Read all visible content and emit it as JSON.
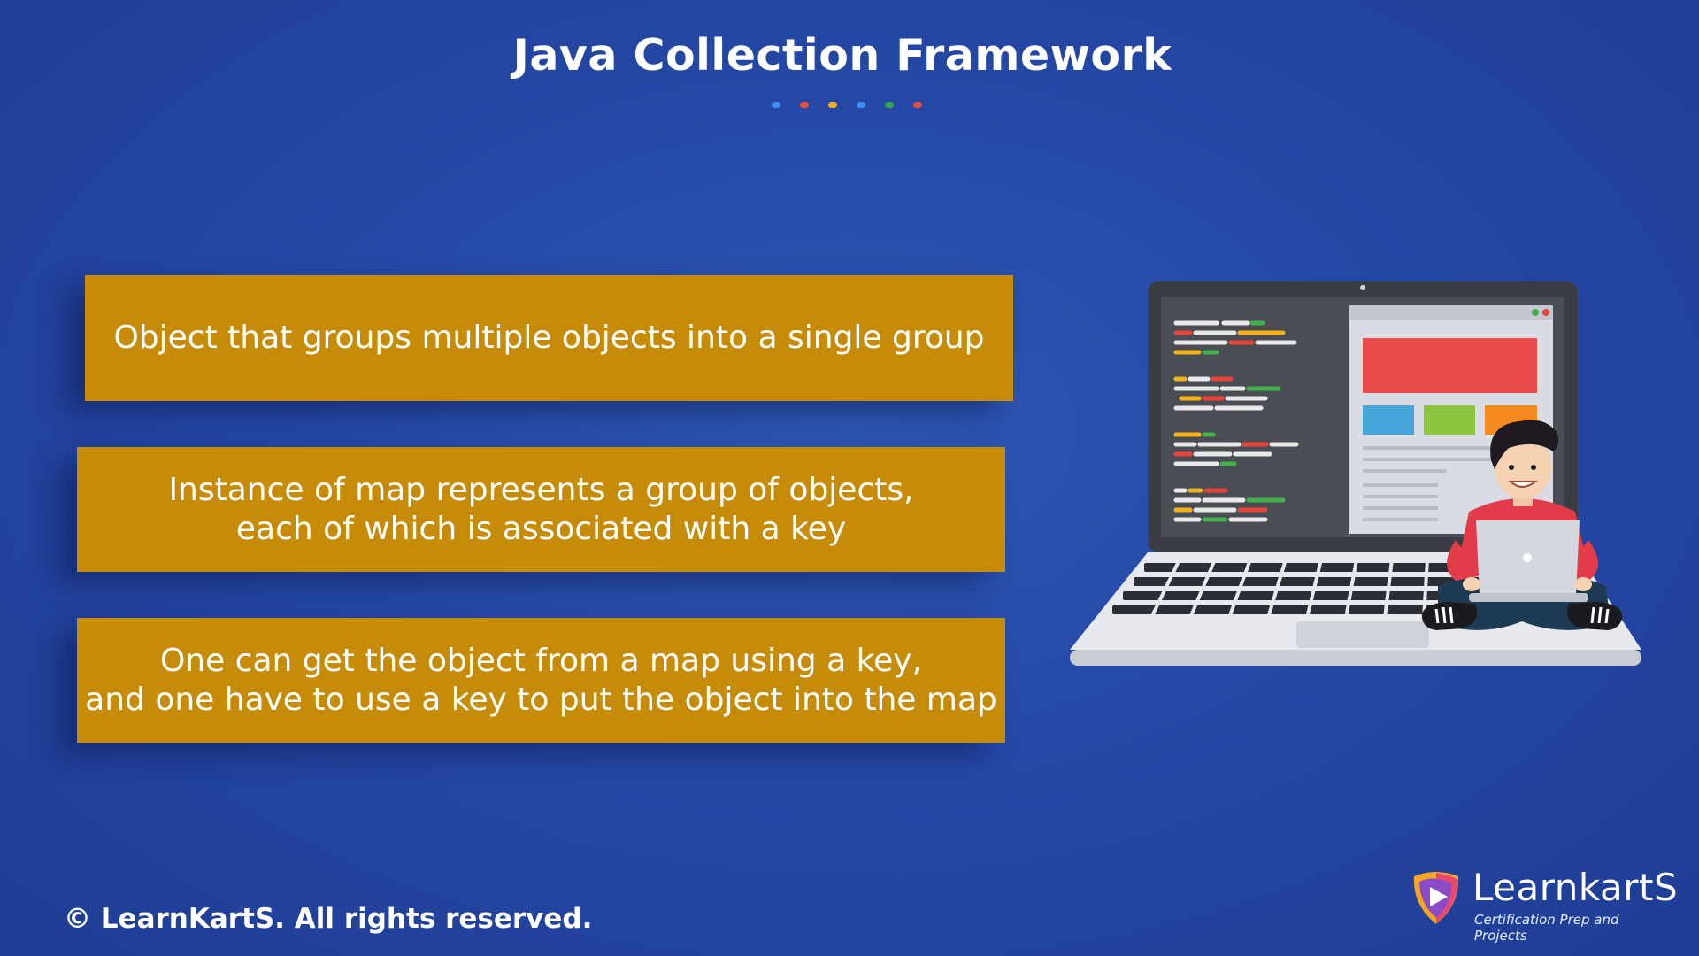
{
  "title": "Java Collection Framework",
  "accent_dots": [
    "#3a8ef6",
    "#e94b3c",
    "#f2b21b",
    "#3a8ef6",
    "#2fa84f",
    "#e94b3c"
  ],
  "cards": [
    {
      "text": "Object that groups multiple objects into a single group"
    },
    {
      "text": "Instance of map represents a group of objects,\neach of which is associated with a key"
    },
    {
      "text": "One can get the object from a map using a key,\nand one have to use a key to put the object into the map"
    }
  ],
  "colors": {
    "background": "#2548a6",
    "card": "#c68c08",
    "text": "#ffffff"
  },
  "footer": {
    "copyright": "© LearnKartS. All rights reserved."
  },
  "logo": {
    "name": "LearnkartS",
    "tagline": "Certification Prep and Projects",
    "icon": "play-shield-icon"
  },
  "illustration": {
    "icon": "person-with-laptop-illustration"
  }
}
